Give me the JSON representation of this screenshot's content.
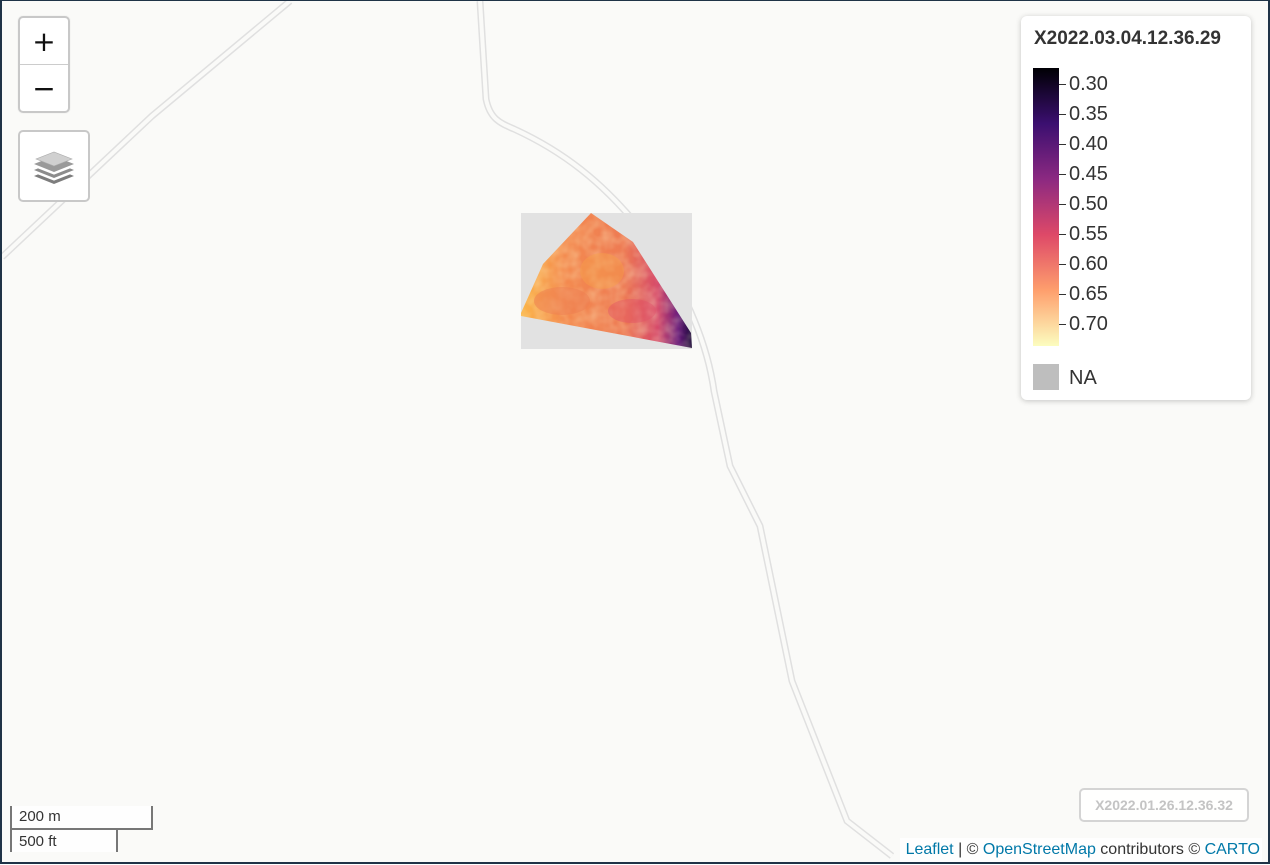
{
  "zoom": {
    "in_label": "+",
    "out_label": "−"
  },
  "layers_control": {
    "icon": "layers-icon"
  },
  "legend": {
    "title": "X2022.03.04.12.36.29",
    "ticks": [
      "0.30",
      "0.35",
      "0.40",
      "0.45",
      "0.50",
      "0.55",
      "0.60",
      "0.65",
      "0.70"
    ],
    "na_label": "NA",
    "na_color": "#bebebe",
    "colors": [
      "#000004",
      "#3b0f70",
      "#8c2981",
      "#de4968",
      "#fe9f6d",
      "#fcfdbf"
    ]
  },
  "layer_tag": "X2022.01.26.12.36.32",
  "scale": {
    "metric": "200 m",
    "imperial": "500 ft"
  },
  "attribution": {
    "leaflet": "Leaflet",
    "separator": " | © ",
    "osm": "OpenStreetMap",
    "contributors": " contributors © ",
    "carto": "CARTO"
  }
}
